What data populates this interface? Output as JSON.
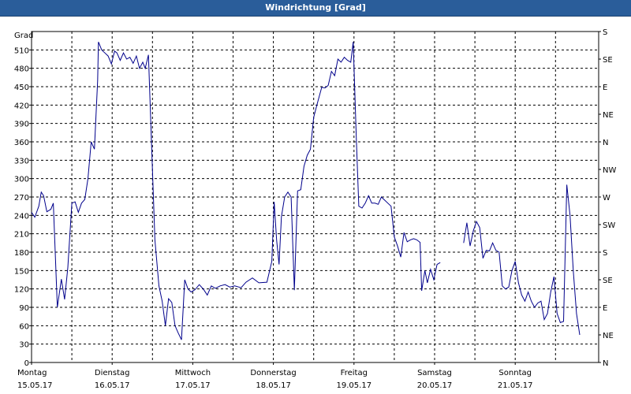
{
  "window": {
    "title": "Windrichtung [Grad]"
  },
  "chart_data": {
    "type": "line",
    "title": "Windrichtung [Grad]",
    "ylabel": "Grad",
    "ylim": [
      0,
      540
    ],
    "yticks": [
      0,
      30,
      60,
      90,
      120,
      150,
      180,
      210,
      240,
      270,
      300,
      330,
      360,
      390,
      420,
      450,
      480,
      510
    ],
    "right_axis_labels": [
      "N",
      "NE",
      "E",
      "SE",
      "S",
      "SW",
      "W",
      "NW",
      "N",
      "NE",
      "E",
      "SE",
      "S"
    ],
    "x_unit": "day",
    "xlim": [
      0,
      7
    ],
    "x_ticks": [
      {
        "day": 0,
        "weekday": "Montag",
        "date": "15.05.17"
      },
      {
        "day": 1,
        "weekday": "Dienstag",
        "date": "16.05.17"
      },
      {
        "day": 2,
        "weekday": "Mittwoch",
        "date": "17.05.17"
      },
      {
        "day": 3,
        "weekday": "Donnerstag",
        "date": "18.05.17"
      },
      {
        "day": 4,
        "weekday": "Freitag",
        "date": "19.05.17"
      },
      {
        "day": 5,
        "weekday": "Samstag",
        "date": "20.05.17"
      },
      {
        "day": 6,
        "weekday": "Sonntag",
        "date": "21.05.17"
      }
    ],
    "grid": true,
    "line_color": "#00008b",
    "series": [
      {
        "segments": [
          [
            [
              0.0,
              245
            ],
            [
              0.04,
              237
            ],
            [
              0.09,
              255
            ],
            [
              0.12,
              278
            ],
            [
              0.15,
              272
            ],
            [
              0.19,
              246
            ],
            [
              0.24,
              250
            ],
            [
              0.27,
              260
            ],
            [
              0.32,
              90
            ],
            [
              0.37,
              136
            ],
            [
              0.41,
              103
            ],
            [
              0.45,
              155
            ],
            [
              0.5,
              260
            ],
            [
              0.54,
              262
            ],
            [
              0.58,
              245
            ],
            [
              0.62,
              260
            ],
            [
              0.66,
              266
            ],
            [
              0.7,
              300
            ],
            [
              0.74,
              360
            ],
            [
              0.78,
              348
            ],
            [
              0.82,
              460
            ],
            [
              0.83,
              523
            ],
            [
              0.87,
              510
            ],
            [
              0.91,
              505
            ],
            [
              0.95,
              500
            ],
            [
              0.99,
              487
            ],
            [
              1.03,
              508
            ],
            [
              1.06,
              505
            ],
            [
              1.1,
              493
            ],
            [
              1.14,
              505
            ],
            [
              1.18,
              495
            ],
            [
              1.22,
              498
            ],
            [
              1.26,
              488
            ],
            [
              1.3,
              500
            ],
            [
              1.34,
              480
            ],
            [
              1.38,
              490
            ],
            [
              1.41,
              480
            ],
            [
              1.45,
              502
            ],
            [
              1.49,
              350
            ],
            [
              1.53,
              200
            ],
            [
              1.58,
              125
            ],
            [
              1.62,
              100
            ],
            [
              1.66,
              60
            ],
            [
              1.7,
              104
            ],
            [
              1.74,
              98
            ],
            [
              1.78,
              60
            ],
            [
              1.82,
              48
            ],
            [
              1.86,
              37
            ],
            [
              1.9,
              135
            ],
            [
              1.94,
              120
            ],
            [
              1.98,
              115
            ],
            [
              2.03,
              119
            ],
            [
              2.08,
              127
            ],
            [
              2.13,
              120
            ],
            [
              2.18,
              110
            ],
            [
              2.23,
              125
            ],
            [
              2.28,
              121
            ],
            [
              2.34,
              125
            ],
            [
              2.4,
              127
            ],
            [
              2.46,
              123
            ],
            [
              2.52,
              125
            ],
            [
              2.6,
              122
            ],
            [
              2.66,
              131
            ],
            [
              2.74,
              138
            ],
            [
              2.82,
              130
            ],
            [
              2.92,
              131
            ],
            [
              2.98,
              165
            ],
            [
              3.01,
              262
            ],
            [
              3.04,
              200
            ],
            [
              3.07,
              160
            ],
            [
              3.1,
              238
            ],
            [
              3.14,
              270
            ],
            [
              3.18,
              278
            ],
            [
              3.22,
              270
            ],
            [
              3.26,
              118
            ],
            [
              3.3,
              280
            ],
            [
              3.34,
              282
            ],
            [
              3.38,
              320
            ],
            [
              3.42,
              338
            ],
            [
              3.46,
              348
            ],
            [
              3.5,
              400
            ],
            [
              3.55,
              425
            ],
            [
              3.6,
              449
            ],
            [
              3.64,
              448
            ],
            [
              3.68,
              452
            ],
            [
              3.72,
              475
            ],
            [
              3.76,
              468
            ],
            [
              3.8,
              495
            ],
            [
              3.84,
              490
            ],
            [
              3.88,
              498
            ],
            [
              3.92,
              493
            ],
            [
              3.96,
              490
            ],
            [
              3.99,
              523
            ],
            [
              4.03,
              360
            ],
            [
              4.06,
              255
            ],
            [
              4.1,
              252
            ],
            [
              4.14,
              260
            ],
            [
              4.18,
              272
            ],
            [
              4.22,
              260
            ],
            [
              4.26,
              260
            ],
            [
              4.3,
              258
            ],
            [
              4.34,
              270
            ],
            [
              4.38,
              265
            ],
            [
              4.42,
              260
            ],
            [
              4.46,
              255
            ],
            [
              4.5,
              205
            ],
            [
              4.54,
              190
            ],
            [
              4.58,
              172
            ],
            [
              4.62,
              212
            ],
            [
              4.66,
              197
            ],
            [
              4.7,
              200
            ],
            [
              4.74,
              202
            ],
            [
              4.78,
              200
            ],
            [
              4.82,
              196
            ],
            [
              4.84,
              117
            ],
            [
              4.88,
              150
            ],
            [
              4.91,
              130
            ],
            [
              4.95,
              152
            ],
            [
              4.99,
              135
            ],
            [
              5.03,
              160
            ],
            [
              5.07,
              163
            ]
          ],
          [
            [
              5.36,
              195
            ],
            [
              5.4,
              228
            ],
            [
              5.44,
              190
            ],
            [
              5.48,
              215
            ],
            [
              5.52,
              230
            ],
            [
              5.56,
              220
            ],
            [
              5.6,
              170
            ],
            [
              5.64,
              183
            ],
            [
              5.68,
              182
            ],
            [
              5.72,
              195
            ],
            [
              5.76,
              183
            ],
            [
              5.8,
              180
            ],
            [
              5.84,
              125
            ],
            [
              5.88,
              120
            ],
            [
              5.92,
              123
            ],
            [
              5.96,
              150
            ],
            [
              6.0,
              165
            ],
            [
              6.04,
              130
            ],
            [
              6.08,
              110
            ],
            [
              6.12,
              100
            ],
            [
              6.16,
              115
            ],
            [
              6.2,
              100
            ],
            [
              6.24,
              90
            ],
            [
              6.28,
              97
            ],
            [
              6.32,
              100
            ],
            [
              6.36,
              70
            ],
            [
              6.4,
              80
            ],
            [
              6.44,
              115
            ],
            [
              6.48,
              140
            ],
            [
              6.52,
              80
            ],
            [
              6.56,
              65
            ],
            [
              6.6,
              67
            ],
            [
              6.64,
              290
            ],
            [
              6.68,
              240
            ],
            [
              6.72,
              150
            ],
            [
              6.76,
              80
            ],
            [
              6.8,
              45
            ]
          ]
        ]
      }
    ]
  }
}
